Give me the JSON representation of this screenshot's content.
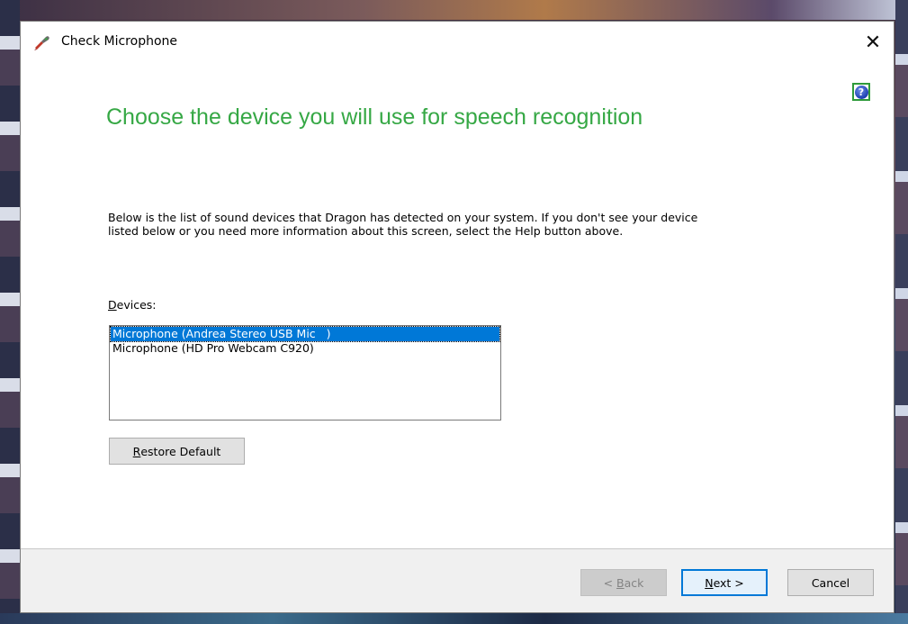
{
  "window": {
    "title": "Check Microphone",
    "close_glyph": "✕",
    "help_glyph": "?"
  },
  "heading": "Choose the device you will use for speech recognition",
  "description": "Below is the list of sound devices that Dragon has detected on your system. If you don't see your device listed below or you need more information about this screen, select the Help button above.",
  "devices": {
    "label_accel": "D",
    "label_rest": "evices:",
    "items": [
      {
        "label": "Microphone (Andrea Stereo USB Mic   )",
        "selected": true
      },
      {
        "label": "Microphone (HD Pro Webcam C920)",
        "selected": false
      }
    ]
  },
  "restore_button": {
    "accel": "R",
    "rest": "estore Default"
  },
  "footer": {
    "back": {
      "prefix": "< ",
      "accel": "B",
      "rest": "ack",
      "enabled": false
    },
    "next": {
      "accel": "N",
      "rest": "ext >"
    },
    "cancel": "Cancel"
  },
  "colors": {
    "heading": "#36a845",
    "selection": "#0078d7",
    "help_border": "#2e9a3a"
  },
  "icons": [
    "dragon-app-icon",
    "close-icon",
    "help-icon"
  ]
}
